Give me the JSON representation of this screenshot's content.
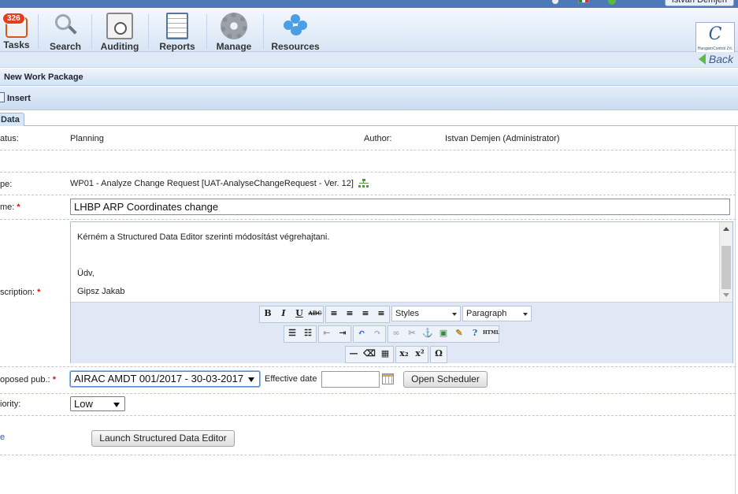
{
  "header": {
    "user_name": "Istvan Demjen"
  },
  "toolbar": {
    "tasks": {
      "label": "Tasks",
      "badge": "326"
    },
    "search": {
      "label": "Search"
    },
    "auditing": {
      "label": "Auditing"
    },
    "reports": {
      "label": "Reports"
    },
    "manage": {
      "label": "Manage"
    },
    "resources": {
      "label": "Resources"
    }
  },
  "logo": {
    "mark": "C",
    "text": "HungaroControl Zrt."
  },
  "back_label": "Back",
  "page_title": "New Work Package",
  "actions": {
    "insert": "Insert"
  },
  "tab": "Data",
  "form": {
    "status": {
      "label": "atus:",
      "value": "Planning"
    },
    "author": {
      "label": "Author:",
      "value": "Istvan Demjen (Administrator)"
    },
    "type": {
      "label": "pe:",
      "value": "WP01 - Analyze Change Request [UAT-AnalyseChangeRequest - Ver. 12]"
    },
    "name": {
      "label": "me:",
      "value": "LHBP ARP Coordinates change"
    },
    "description": {
      "label": "scription:",
      "lines": [
        "Kérném a Structured Data Editor szerinti módosítást végrehajtani.",
        "",
        "Üdv,",
        "Gipsz Jakab"
      ]
    },
    "editor": {
      "styles": "Styles",
      "format": "Paragraph"
    },
    "proposed_pub": {
      "label": "oposed pub.:",
      "value": "AIRAC AMDT 001/2017 - 30-03-2017"
    },
    "effective_date": {
      "label": "Effective date",
      "value": ""
    },
    "open_scheduler": "Open Scheduler",
    "priority": {
      "label": "iority:",
      "value": "Low"
    },
    "launch_editor": "Launch Structured Data Editor",
    "required_mark": "*"
  }
}
